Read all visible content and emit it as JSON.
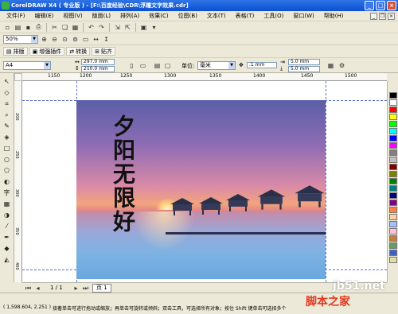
{
  "titlebar": {
    "title": "CorelDRAW X4 ( 专业版 ) - [F:\\百度经验\\CDR\\浮雕文字效果.cdr]"
  },
  "menu": [
    "文件(F)",
    "编辑(E)",
    "视图(V)",
    "版面(L)",
    "排列(A)",
    "效果(C)",
    "位图(B)",
    "文本(T)",
    "表格(T)",
    "工具(O)",
    "窗口(W)",
    "帮助(H)"
  ],
  "toolbar2": {
    "zoom": "50%"
  },
  "pluginbar": {
    "items": [
      "排版",
      "增强插件",
      "转换",
      "贴齐"
    ]
  },
  "propbar": {
    "paper": "A4",
    "width": "297.0 mm",
    "height": "210.0 mm",
    "unit_label": "单位:",
    "unit": "毫米",
    "nudge": ".1 mm",
    "dup_x": "5.0 mm",
    "dup_y": "5.0 mm"
  },
  "ruler": {
    "h_ticks": [
      "1150",
      "1200",
      "1250",
      "1300",
      "1350",
      "1400",
      "1450",
      "1500"
    ],
    "v_ticks": [
      "200",
      "250",
      "300",
      "350",
      "400"
    ]
  },
  "artwork": {
    "calligraphy": "夕阳无限好"
  },
  "pages": {
    "count": "1 / 1",
    "tab": "页 1"
  },
  "status": {
    "coords": "( 1,598.604, 2.251 )",
    "hint": "接著单击可进行拖动或缩放；再单击可旋转或倾斜；双击工具，可选择所有对象；按住 Shift 键单击可选择多个"
  },
  "watermark": {
    "site": "jb51.net",
    "name": "脚本之家"
  },
  "palette_colors": [
    "#000000",
    "#ffffff",
    "#ff0000",
    "#ffff00",
    "#00ff00",
    "#00ffff",
    "#0000ff",
    "#ff00ff",
    "#808080",
    "#c0c0c0",
    "#800000",
    "#808000",
    "#008000",
    "#008080",
    "#000080",
    "#800080",
    "#ff8040",
    "#ffd0a0",
    "#a0c0ff",
    "#ffc0e0",
    "#c08040",
    "#60a060",
    "#4060c0",
    "#e0e0a0"
  ]
}
